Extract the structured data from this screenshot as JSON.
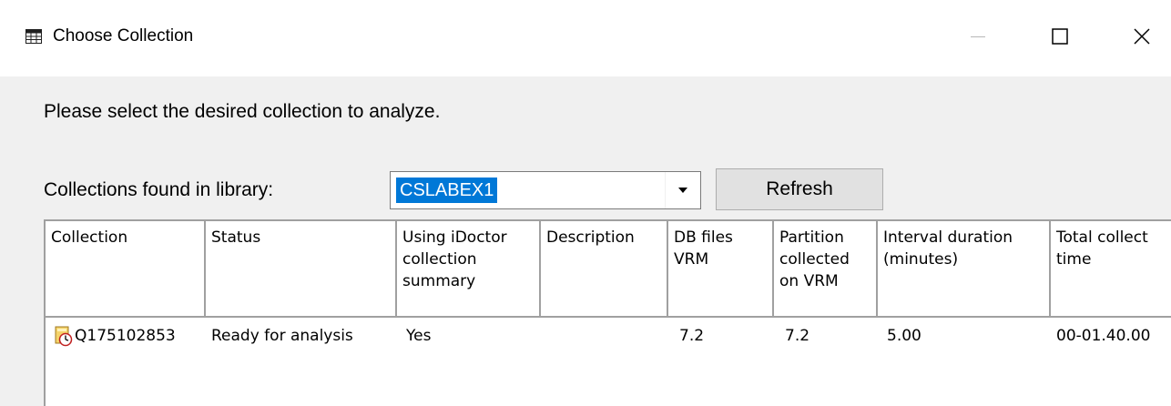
{
  "window": {
    "title": "Choose Collection",
    "icon": "grid-icon"
  },
  "prompt": "Please select the desired collection to analyze.",
  "library": {
    "label": "Collections found in library:",
    "selected": "CSLABEX1",
    "refresh_label": "Refresh"
  },
  "table": {
    "columns": [
      {
        "label": "Collection"
      },
      {
        "label": "Status"
      },
      {
        "label": "Using iDoctor collection summary"
      },
      {
        "label": "Description"
      },
      {
        "label": "DB files VRM"
      },
      {
        "label": "Partition collected on VRM"
      },
      {
        "label": "Interval duration (minutes)"
      },
      {
        "label": "Total collect time"
      }
    ],
    "rows": [
      {
        "icon": "collection-timer-icon",
        "collection": "Q175102853",
        "status": "Ready for analysis",
        "using_summary": "Yes",
        "description": "",
        "db_vrm": "7.2",
        "partition_vrm": "7.2",
        "interval": "5.00",
        "total_time": "00-01.40.00"
      }
    ]
  },
  "colors": {
    "selection": "#0078d7",
    "grid_line": "#a0a0a0",
    "background": "#f0f0f0"
  }
}
